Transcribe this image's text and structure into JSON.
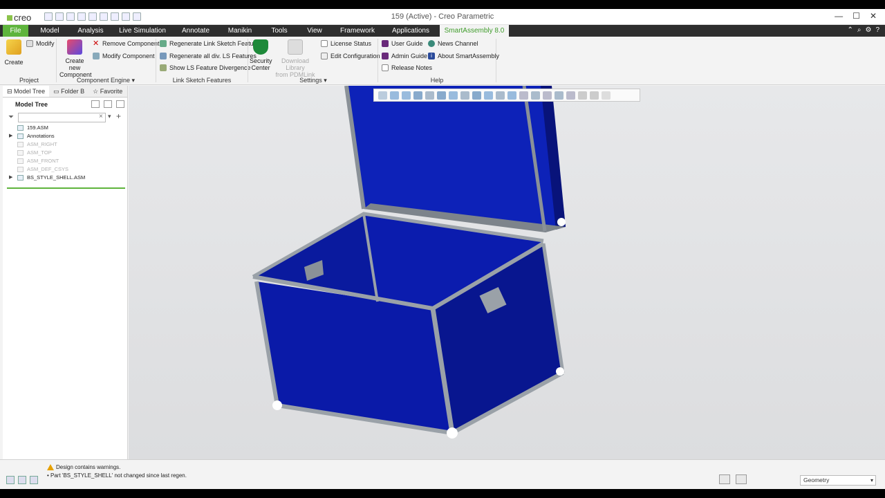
{
  "window": {
    "app_logo": "creo",
    "title": "159 (Active) - Creo Parametric",
    "controls": [
      "—",
      "☐",
      "✕"
    ]
  },
  "ribbon_tabs": [
    "File",
    "Model",
    "Analysis",
    "Live Simulation",
    "Annotate",
    "Manikin",
    "Tools",
    "View",
    "Framework",
    "Applications",
    "SmartAssembly 8.0"
  ],
  "active_tab": "SmartAssembly 8.0",
  "ribbon": {
    "project": {
      "create": "Create",
      "modify": "Modify",
      "label": "Project"
    },
    "component_engine": {
      "create_new": "Create new Component",
      "create_new_l1": "Create new",
      "create_new_l2": "Component",
      "remove": "Remove Component",
      "modify": "Modify Component",
      "label": "Component Engine"
    },
    "link_sketch": {
      "regen": "Regenerate Link Sketch Feature",
      "regen_all": "Regenerate all div. LS Features",
      "show_div": "Show LS Feature Divergence",
      "label": "Link Sketch Features"
    },
    "settings": {
      "security_l1": "Security",
      "security_l2": "Center",
      "download_l1": "Download Library",
      "download_l2": "from PDMLink",
      "license": "License Status",
      "edit_config": "Edit Configuration",
      "label": "Settings"
    },
    "help": {
      "user_guide": "User Guide",
      "admin_guide": "Admin Guide",
      "release_notes": "Release Notes",
      "news": "News Channel",
      "about": "About SmartAssembly",
      "label": "Help"
    }
  },
  "left_panel": {
    "tabs": [
      "Model Tree",
      "Folder B",
      "Favorite"
    ],
    "header": "Model Tree",
    "search_placeholder": "",
    "tree": [
      {
        "label": "159.ASM",
        "dim": false,
        "expander": ""
      },
      {
        "label": "Annotations",
        "dim": false,
        "expander": "▶"
      },
      {
        "label": "ASM_RIGHT",
        "dim": true,
        "expander": ""
      },
      {
        "label": "ASM_TOP",
        "dim": true,
        "expander": ""
      },
      {
        "label": "ASM_FRONT",
        "dim": true,
        "expander": ""
      },
      {
        "label": "ASM_DEF_CSYS",
        "dim": true,
        "expander": ""
      },
      {
        "label": "BS_STYLE_SHELL.ASM",
        "dim": false,
        "expander": "▶"
      }
    ]
  },
  "status": {
    "warning": "Design contains warnings.",
    "message": "• Part 'BS_STYLE_SHELL' not changed since last regen.",
    "filter_value": "Geometry"
  },
  "colors": {
    "accent_green": "#5eb43c",
    "tab_bar": "#2e2e2e",
    "box_blue": "#0a1aa8",
    "frame_grey": "#9aa1a8"
  }
}
